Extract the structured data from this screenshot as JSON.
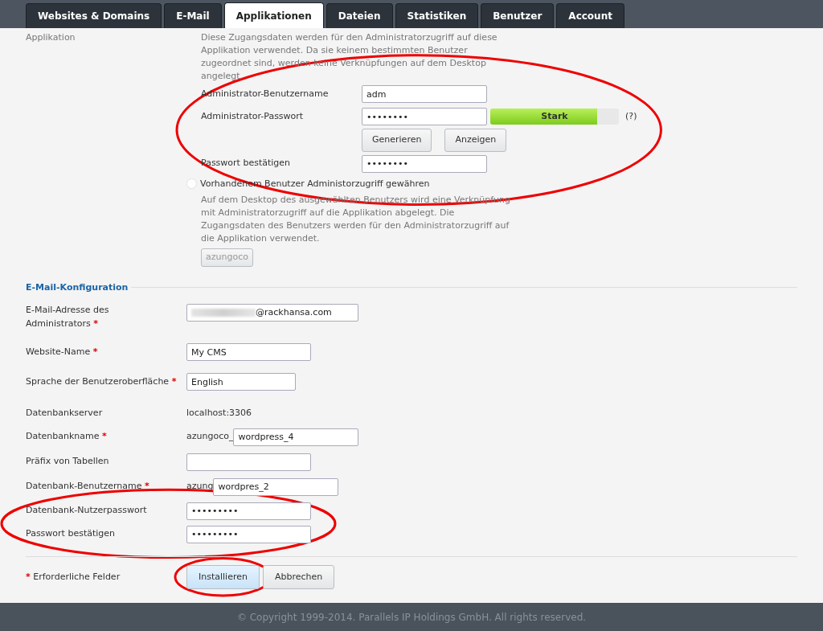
{
  "tabs": [
    {
      "label": "Websites & Domains",
      "selected": false
    },
    {
      "label": "E-Mail",
      "selected": false
    },
    {
      "label": "Applikationen",
      "selected": true
    },
    {
      "label": "Dateien",
      "selected": false
    },
    {
      "label": "Statistiken",
      "selected": false
    },
    {
      "label": "Benutzer",
      "selected": false
    },
    {
      "label": "Account",
      "selected": false
    }
  ],
  "application": {
    "label": "Applikation",
    "note": "Diese Zugangsdaten werden für den Administratorzugriff auf diese Applikation verwendet. Da sie keinem bestimmten Benutzer zugeordnet sind, werden keine Verknüpfungen auf dem Desktop angelegt.",
    "username": {
      "label": "Administrator-Benutzername",
      "value": "adm"
    },
    "password": {
      "label": "Administrator-Passwort",
      "value": "••••••••",
      "strength": {
        "text": "Stark",
        "level": 0.83
      },
      "help": "(?)"
    },
    "buttons": [
      "Generieren",
      "Anzeigen"
    ],
    "confirm": {
      "label": "Passwort bestätigen",
      "value": "••••••••"
    },
    "existing_user": {
      "label": "Vorhandenem Benutzer Administorzugriff gewähren",
      "checked": false,
      "note": "Auf dem Desktop des ausgewählten Benutzers wird eine Verknüpfung mit Administratorzugriff auf die Applikation abgelegt. Die Zugangsdaten des Benutzers werden für den Administratorzugriff auf die Applikation verwendet.",
      "user_button": {
        "label": "azungoco",
        "disabled": true
      }
    }
  },
  "email_section": {
    "title": "E-Mail-Konfiguration",
    "fields": [
      {
        "kind": "input",
        "label": "E-Mail-Adresse des Administrators",
        "required": true,
        "value": "@rackhansa.com",
        "redacted": true
      },
      {
        "kind": "input",
        "label": "Website-Name",
        "required": true,
        "value": "My CMS"
      },
      {
        "kind": "input",
        "label": "Sprache der Benutzeroberfläche",
        "required": true,
        "value": "English"
      },
      {
        "kind": "text",
        "label": "Datenbankserver",
        "required": false,
        "value": "localhost:3306"
      },
      {
        "kind": "prefixed",
        "label": "Datenbankname",
        "required": true,
        "prefix": "azungoco_",
        "value": "wordpress_4"
      },
      {
        "kind": "input",
        "label": "Präfix von Tabellen",
        "required": false
      },
      {
        "kind": "prefixed",
        "label": "Datenbank-Benutzername",
        "required": true,
        "prefix": "azung",
        "value": "wordpres_2"
      },
      {
        "kind": "input",
        "label": "Datenbank-Nutzerpasswort",
        "required": false,
        "value": "•••••••••"
      },
      {
        "kind": "input",
        "label": "Passwort bestätigen",
        "required": false,
        "value": "•••••••••"
      }
    ]
  },
  "required_note": {
    "star": "*",
    "text": "Erforderliche Felder"
  },
  "actions": [
    {
      "label": "Installieren",
      "primary": true
    },
    {
      "label": "Abbrechen",
      "primary": false
    }
  ],
  "footer": "© Copyright 1999-2014. Parallels IP Holdings GmbH. All rights reserved."
}
